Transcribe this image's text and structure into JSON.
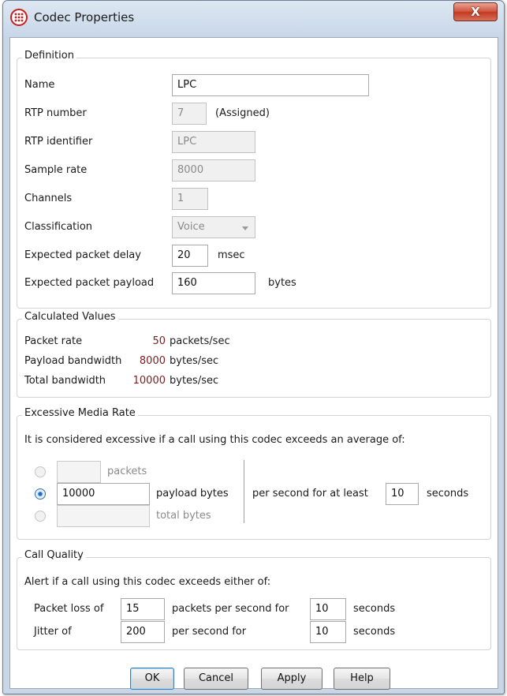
{
  "window": {
    "title": "Codec Properties",
    "close_label": "X"
  },
  "definition": {
    "title": "Definition",
    "name_label": "Name",
    "name_value": "LPC",
    "rtp_number_label": "RTP number",
    "rtp_number_value": "7",
    "rtp_number_note": "(Assigned)",
    "rtp_identifier_label": "RTP identifier",
    "rtp_identifier_value": "LPC",
    "sample_rate_label": "Sample rate",
    "sample_rate_value": "8000",
    "channels_label": "Channels",
    "channels_value": "1",
    "classification_label": "Classification",
    "classification_value": "Voice",
    "packet_delay_label": "Expected packet delay",
    "packet_delay_value": "20",
    "packet_delay_unit": "msec",
    "packet_payload_label": "Expected packet payload",
    "packet_payload_value": "160",
    "packet_payload_unit": "bytes"
  },
  "calculated": {
    "title": "Calculated Values",
    "rows": [
      {
        "label": "Packet rate",
        "value": "50",
        "unit": "packets/sec"
      },
      {
        "label": "Payload bandwidth",
        "value": "8000",
        "unit": "bytes/sec"
      },
      {
        "label": "Total bandwidth",
        "value": "10000",
        "unit": "bytes/sec"
      }
    ]
  },
  "excessive": {
    "title": "Excessive Media Rate",
    "description": "It is considered excessive if a call using this codec exceeds an average of:",
    "options": [
      {
        "value": "",
        "label": "packets",
        "selected": false
      },
      {
        "value": "10000",
        "label": "payload bytes",
        "selected": true
      },
      {
        "value": "",
        "label": "total bytes",
        "selected": false
      }
    ],
    "per_second_label": "per second for at least",
    "seconds_value": "10",
    "seconds_label": "seconds"
  },
  "call_quality": {
    "title": "Call Quality",
    "description": "Alert if a call using this codec exceeds either of:",
    "packet_loss_label": "Packet loss of",
    "packet_loss_value": "15",
    "packet_loss_rate_label": "packets per second for",
    "packet_loss_seconds_value": "10",
    "packet_loss_seconds_label": "seconds",
    "jitter_label": "Jitter of",
    "jitter_value": "200",
    "jitter_rate_label": "per second for",
    "jitter_seconds_value": "10",
    "jitter_seconds_label": "seconds"
  },
  "buttons": {
    "ok": "OK",
    "cancel": "Cancel",
    "apply": "Apply",
    "help": "Help"
  },
  "colors": {
    "value_text": "#7a1d1d",
    "selection_accent": "#2d7ad6"
  },
  "icons": {
    "app": "telephone-keypad-icon",
    "close": "close-icon"
  }
}
